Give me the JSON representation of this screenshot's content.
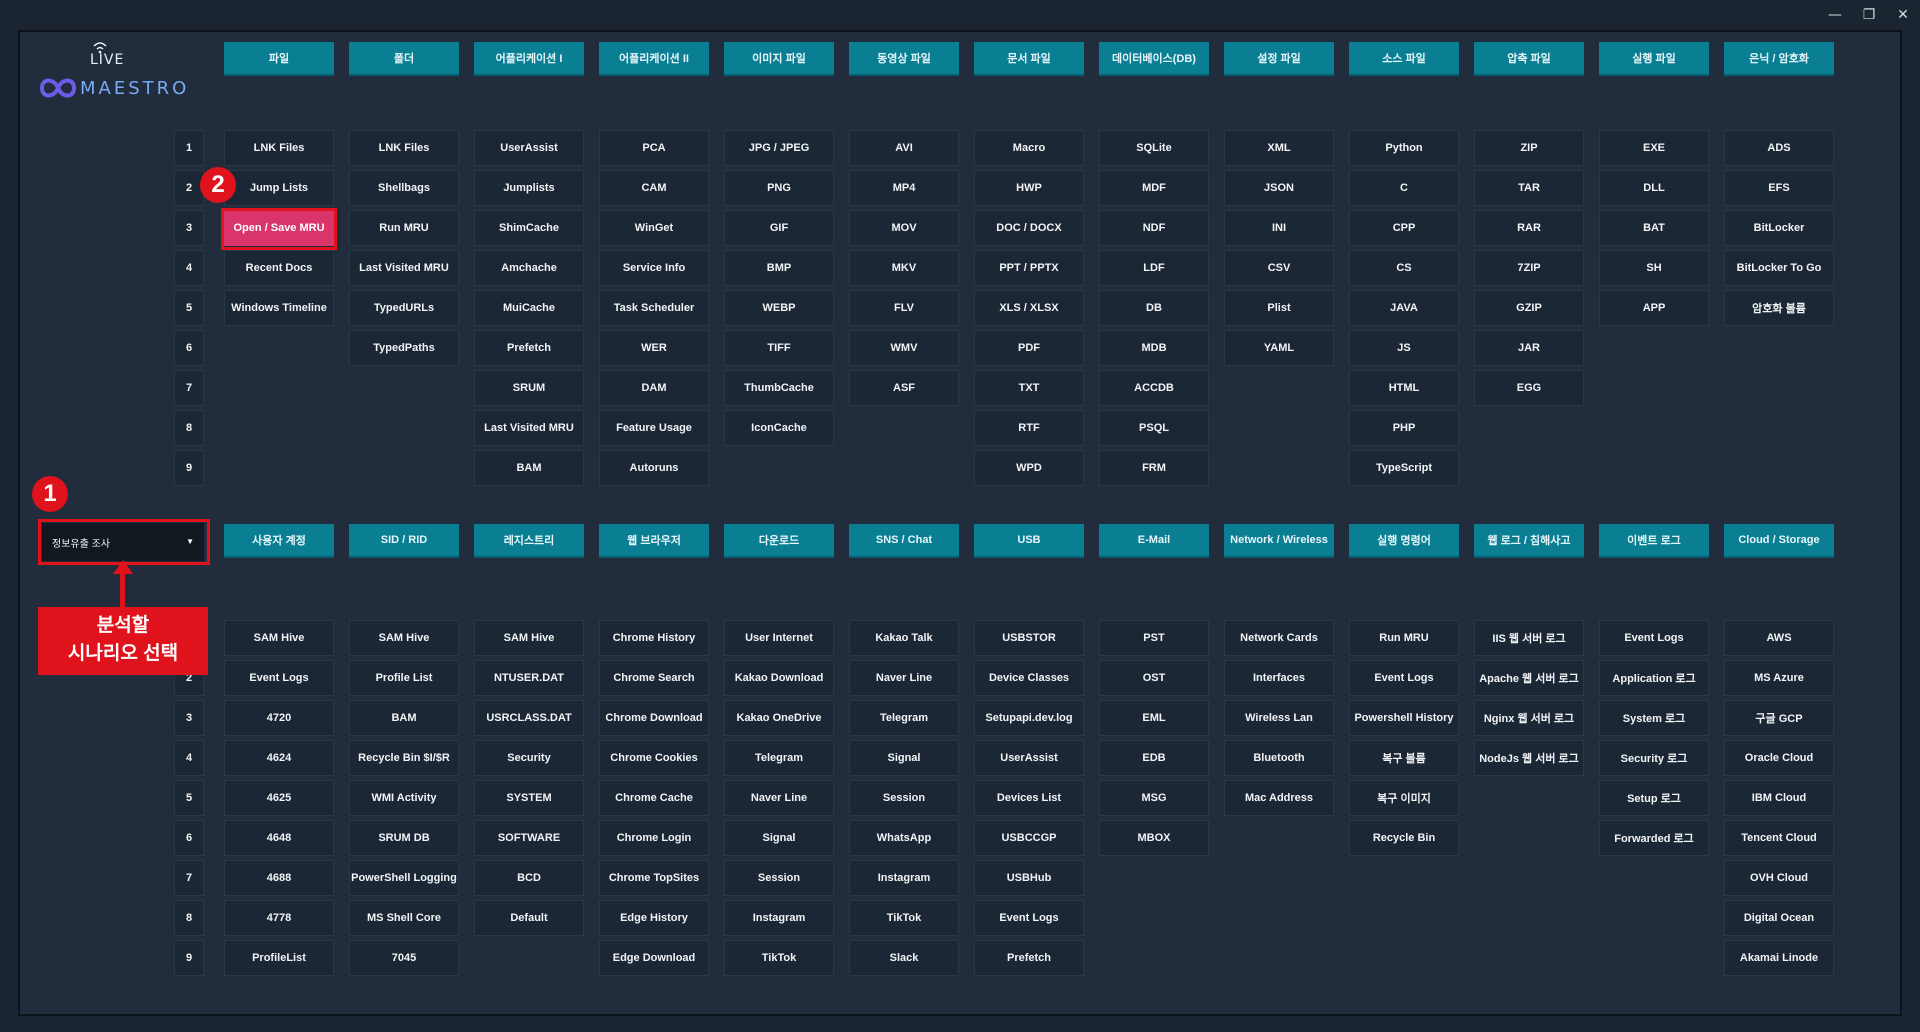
{
  "window": {
    "controls": {
      "minimize": "—",
      "restore": "❐",
      "close": "✕"
    }
  },
  "logo": {
    "live": "LIVE",
    "name": "MAESTRO"
  },
  "row_numbers": [
    "1",
    "2",
    "3",
    "4",
    "5",
    "6",
    "7",
    "8",
    "9"
  ],
  "top_section": {
    "columns": [
      {
        "label": "파일",
        "items": [
          "LNK Files",
          "Jump Lists",
          "Open / Save MRU",
          "Recent Docs",
          "Windows Timeline"
        ]
      },
      {
        "label": "폴더",
        "items": [
          "LNK Files",
          "Shellbags",
          "Run MRU",
          "Last Visited MRU",
          "TypedURLs",
          "TypedPaths"
        ]
      },
      {
        "label": "어플리케이션 I",
        "items": [
          "UserAssist",
          "Jumplists",
          "ShimCache",
          "Amchache",
          "MuiCache",
          "Prefetch",
          "SRUM",
          "Last Visited MRU",
          "BAM"
        ]
      },
      {
        "label": "어플리케이션 II",
        "items": [
          "PCA",
          "CAM",
          "WinGet",
          "Service Info",
          "Task Scheduler",
          "WER",
          "DAM",
          "Feature Usage",
          "Autoruns"
        ]
      },
      {
        "label": "이미지 파일",
        "items": [
          "JPG / JPEG",
          "PNG",
          "GIF",
          "BMP",
          "WEBP",
          "TIFF",
          "ThumbCache",
          "IconCache"
        ]
      },
      {
        "label": "동영상 파일",
        "items": [
          "AVI",
          "MP4",
          "MOV",
          "MKV",
          "FLV",
          "WMV",
          "ASF"
        ]
      },
      {
        "label": "문서 파일",
        "items": [
          "Macro",
          "HWP",
          "DOC / DOCX",
          "PPT / PPTX",
          "XLS / XLSX",
          "PDF",
          "TXT",
          "RTF",
          "WPD"
        ]
      },
      {
        "label": "데이터베이스(DB)",
        "items": [
          "SQLite",
          "MDF",
          "NDF",
          "LDF",
          "DB",
          "MDB",
          "ACCDB",
          "PSQL",
          "FRM"
        ]
      },
      {
        "label": "설정 파일",
        "items": [
          "XML",
          "JSON",
          "INI",
          "CSV",
          "Plist",
          "YAML"
        ]
      },
      {
        "label": "소스 파일",
        "items": [
          "Python",
          "C",
          "CPP",
          "CS",
          "JAVA",
          "JS",
          "HTML",
          "PHP",
          "TypeScript"
        ]
      },
      {
        "label": "압축 파일",
        "items": [
          "ZIP",
          "TAR",
          "RAR",
          "7ZIP",
          "GZIP",
          "JAR",
          "EGG"
        ]
      },
      {
        "label": "실행 파일",
        "items": [
          "EXE",
          "DLL",
          "BAT",
          "SH",
          "APP"
        ]
      },
      {
        "label": "은닉 / 암호화",
        "items": [
          "ADS",
          "EFS",
          "BitLocker",
          "BitLocker To Go",
          "암호화 볼륨"
        ]
      }
    ],
    "active": {
      "column": 0,
      "row": 2
    }
  },
  "bottom_section": {
    "columns": [
      {
        "label": "사용자 계정",
        "items": [
          "SAM Hive",
          "Event Logs",
          "4720",
          "4624",
          "4625",
          "4648",
          "4688",
          "4778",
          "ProfileList"
        ]
      },
      {
        "label": "SID / RID",
        "items": [
          "SAM Hive",
          "Profile List",
          "BAM",
          "Recycle Bin $I/$R",
          "WMI Activity",
          "SRUM DB",
          "PowerShell Logging",
          "MS Shell Core",
          "7045"
        ]
      },
      {
        "label": "레지스트리",
        "items": [
          "SAM Hive",
          "NTUSER.DAT",
          "USRCLASS.DAT",
          "Security",
          "SYSTEM",
          "SOFTWARE",
          "BCD",
          "Default"
        ]
      },
      {
        "label": "웹 브라우저",
        "items": [
          "Chrome History",
          "Chrome Search",
          "Chrome Download",
          "Chrome Cookies",
          "Chrome Cache",
          "Chrome Login",
          "Chrome TopSites",
          "Edge History",
          "Edge Download"
        ]
      },
      {
        "label": "다운로드",
        "items": [
          "User Internet",
          "Kakao Download",
          "Kakao OneDrive",
          "Telegram",
          "Naver Line",
          "Signal",
          "Session",
          "Instagram",
          "TikTok"
        ]
      },
      {
        "label": "SNS / Chat",
        "items": [
          "Kakao Talk",
          "Naver Line",
          "Telegram",
          "Signal",
          "Session",
          "WhatsApp",
          "Instagram",
          "TikTok",
          "Slack"
        ]
      },
      {
        "label": "USB",
        "items": [
          "USBSTOR",
          "Device Classes",
          "Setupapi.dev.log",
          "UserAssist",
          "Devices List",
          "USBCCGP",
          "USBHub",
          "Event Logs",
          "Prefetch"
        ]
      },
      {
        "label": "E-Mail",
        "items": [
          "PST",
          "OST",
          "EML",
          "EDB",
          "MSG",
          "MBOX"
        ]
      },
      {
        "label": "Network / Wireless",
        "items": [
          "Network Cards",
          "Interfaces",
          "Wireless Lan",
          "Bluetooth",
          "Mac Address"
        ]
      },
      {
        "label": "실행 명령어",
        "items": [
          "Run MRU",
          "Event Logs",
          "Powershell History",
          "복구 볼륨",
          "복구 이미지",
          "Recycle Bin"
        ]
      },
      {
        "label": "웹 로그 / 침해사고",
        "items": [
          "IIS 웹 서버 로그",
          "Apache 웹 서버 로그",
          "Nginx 웹 서버 로그",
          "NodeJs 웹 서버 로그"
        ]
      },
      {
        "label": "이벤트 로그",
        "items": [
          "Event Logs",
          "Application 로그",
          "System 로그",
          "Security 로그",
          "Setup 로그",
          "Forwarded 로그"
        ]
      },
      {
        "label": "Cloud / Storage",
        "items": [
          "AWS",
          "MS Azure",
          "구글 GCP",
          "Oracle Cloud",
          "IBM Cloud",
          "Tencent Cloud",
          "OVH Cloud",
          "Digital Ocean",
          "Akamai Linode"
        ]
      }
    ]
  },
  "scenario_select": {
    "value": "정보유출 조사",
    "caret": "▼"
  },
  "annotations": {
    "badge1": "1",
    "badge2": "2",
    "callout_line1": "분석할",
    "callout_line2": "시나리오 선택"
  },
  "colors": {
    "category": "#0a7f93",
    "active": "#d9356b",
    "annotation": "#e0121b"
  }
}
